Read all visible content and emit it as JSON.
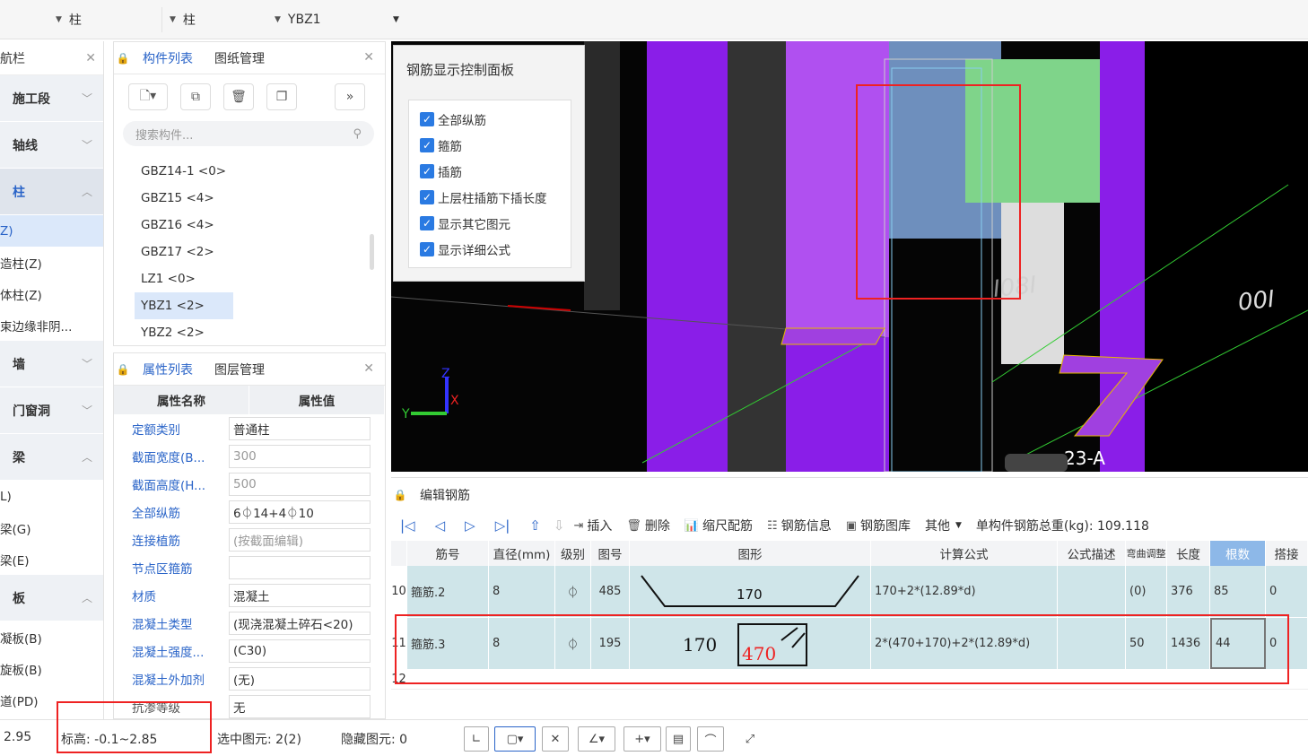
{
  "topbar": {
    "dd1": "柱",
    "dd2": "柱",
    "dd3": "YBZ1"
  },
  "nav": {
    "title": "航栏",
    "items": [
      {
        "label": "施工段"
      },
      {
        "label": "轴线"
      },
      {
        "label": "柱"
      }
    ],
    "sub_col": [
      "Z)",
      "造柱(Z)",
      "体柱(Z)",
      "束边缘非阴..."
    ],
    "cat_wall": "墙",
    "cat_door": "门窗洞",
    "cat_beam": "梁",
    "sub_beam": [
      "L)",
      "梁(G)",
      "梁(E)"
    ],
    "cat_slab": "板",
    "sub_slab": [
      "凝板(B)",
      "旋板(B)",
      "道(PD)"
    ]
  },
  "comp": {
    "tab1": "构件列表",
    "tab2": "图纸管理",
    "search_placeholder": "搜索构件...",
    "items": [
      "GBZ14-1 <0>",
      "GBZ15 <4>",
      "GBZ16 <4>",
      "GBZ17 <2>",
      "LZ1 <0>",
      "YBZ1 <2>",
      "YBZ2 <2>"
    ]
  },
  "props": {
    "tab1": "属性列表",
    "tab2": "图层管理",
    "col1": "属性名称",
    "col2": "属性值",
    "rows": [
      {
        "n": "定额类别",
        "v": "普通柱"
      },
      {
        "n": "截面宽度(B...",
        "v": "300"
      },
      {
        "n": "截面高度(H...",
        "v": "500"
      },
      {
        "n": "全部纵筋",
        "v": "6⏀14+4⏀10"
      },
      {
        "n": "连接植筋",
        "v": "(按截面编辑)"
      },
      {
        "n": "节点区箍筋",
        "v": ""
      },
      {
        "n": "材质",
        "v": "混凝土"
      },
      {
        "n": "混凝土类型",
        "v": "(现浇混凝土碎石<20)"
      },
      {
        "n": "混凝土强度...",
        "v": "(C30)"
      },
      {
        "n": "混凝土外加剂",
        "v": "(无)"
      },
      {
        "n": "抗渗等级",
        "v": "无"
      }
    ]
  },
  "ctrl": {
    "title": "钢筋显示控制面板",
    "items": [
      "全部纵筋",
      "箍筋",
      "插筋",
      "上层柱插筋下插长度",
      "显示其它图元",
      "显示详细公式"
    ]
  },
  "view": {
    "lbl1": "00I",
    "lbl2": "I08I",
    "lbl3": "23-A",
    "axis_z": "Z",
    "axis_y": "Y",
    "axis_x": "X"
  },
  "edit": {
    "title": "编辑钢筋",
    "tools": {
      "insert": "插入",
      "delete": "删除",
      "scale": "缩尺配筋",
      "info": "钢筋信息",
      "lib": "钢筋图库",
      "other": "其他",
      "weight": "单构件钢筋总重(kg): 109.118"
    },
    "headers": [
      "筋号",
      "直径(mm)",
      "级别",
      "图号",
      "图形",
      "计算公式",
      "公式描述",
      "弯曲调整",
      "长度",
      "根数",
      "搭接"
    ],
    "rows": [
      {
        "idx": "10",
        "name": "箍筋.2",
        "dia": "8",
        "grade": "⏀",
        "fig": "485",
        "s1": "170",
        "formula": "170+2*(12.89*d)",
        "desc": "",
        "bend": "(0)",
        "len": "376",
        "cnt": "85",
        "lap": "0"
      },
      {
        "idx": "11",
        "name": "箍筋.3",
        "dia": "8",
        "grade": "⏀",
        "fig": "195",
        "s1": "170",
        "s2": "470",
        "formula": "2*(470+170)+2*(12.89*d)",
        "desc": "",
        "bend": "50",
        "len": "1436",
        "cnt": "44",
        "lap": "0"
      }
    ],
    "row_empty_idx": "12"
  },
  "status": {
    "val": "2.95",
    "elev": "标高:  -0.1~2.85",
    "sel": "选中图元: 2(2)",
    "hidden": "隐藏图元: 0"
  }
}
